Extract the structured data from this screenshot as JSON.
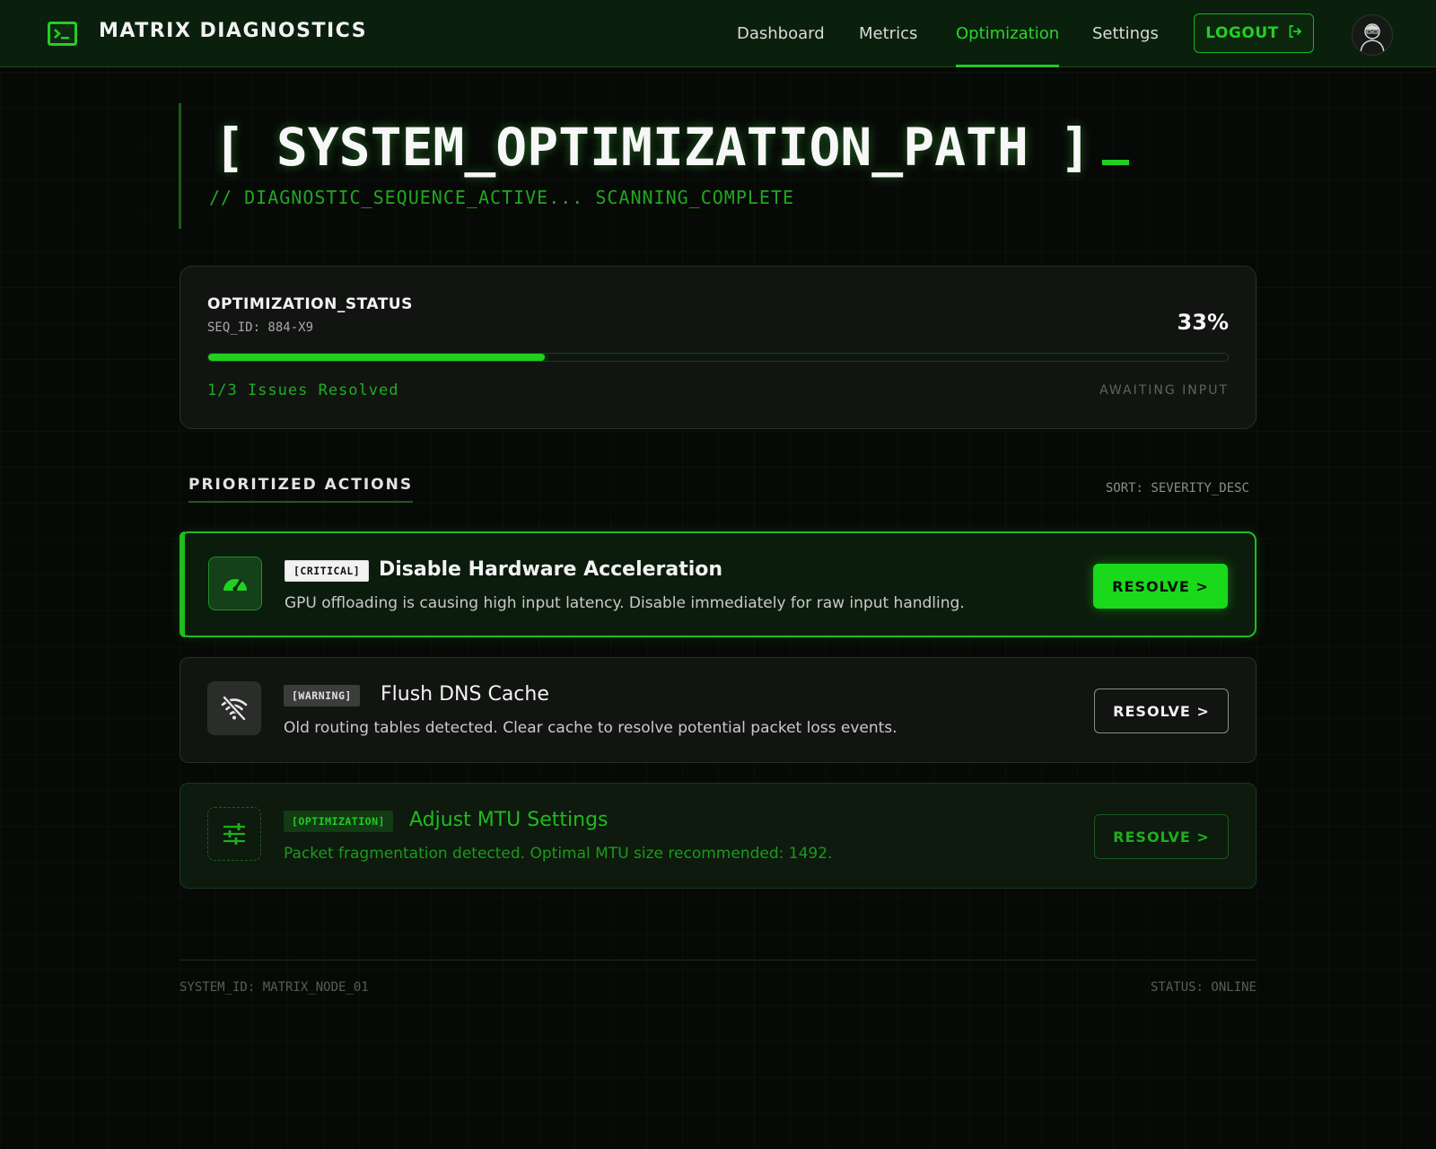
{
  "header": {
    "app_title": "MATRIX DIAGNOSTICS",
    "nav": [
      "Dashboard",
      "Metrics",
      "Optimization",
      "Settings"
    ],
    "active_nav": "Optimization",
    "logout_label": "LOGOUT",
    "accent_color": "#22d022"
  },
  "hero": {
    "title": "[ SYSTEM_OPTIMIZATION_PATH ]",
    "subtitle": "// DIAGNOSTIC_SEQUENCE_ACTIVE... SCANNING_COMPLETE"
  },
  "status": {
    "label": "OPTIMIZATION_STATUS",
    "seq_id": "SEQ_ID: 884-X9",
    "percent_text": "33%",
    "progress": 0.33,
    "issues_text": "1/3 Issues Resolved",
    "state": "AWAITING INPUT"
  },
  "actions_section": {
    "title": "PRIORITIZED ACTIONS",
    "sort": "SORT: SEVERITY_DESC"
  },
  "actions": [
    {
      "tag": "[CRITICAL]",
      "title": "Disable Hardware Acceleration",
      "description": "GPU offloading is causing high input latency. Disable immediately for raw input handling.",
      "button": "RESOLVE >",
      "icon": "speedometer-icon"
    },
    {
      "tag": "[WARNING]",
      "title": "Flush DNS Cache",
      "description": "Old routing tables detected. Clear cache to resolve potential packet loss events.",
      "button": "RESOLVE >",
      "icon": "wifi-off-icon"
    },
    {
      "tag": "[OPTIMIZATION]",
      "title": "Adjust MTU Settings",
      "description": "Packet fragmentation detected. Optimal MTU size recommended: 1492.",
      "button": "RESOLVE >",
      "icon": "sliders-icon"
    }
  ],
  "footer": {
    "system_id": "SYSTEM_ID: MATRIX_NODE_01",
    "status": "STATUS: ONLINE"
  }
}
